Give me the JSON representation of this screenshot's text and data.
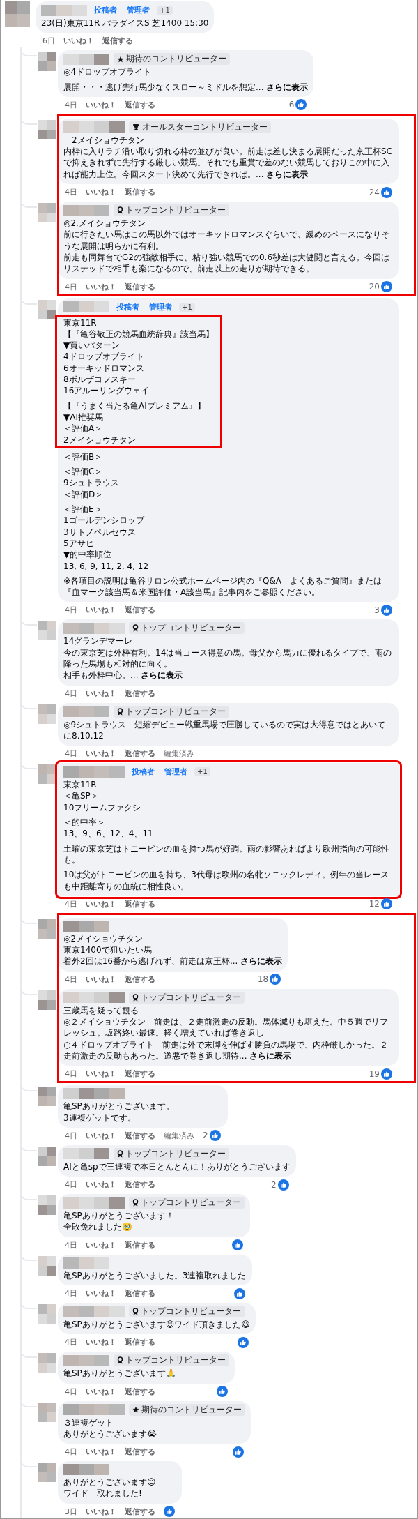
{
  "post": {
    "roles": [
      "投稿者",
      "管理者"
    ],
    "role_more": "+1",
    "paragraphs": [
      [
        "23(日)東京11R パラダイスS 芝1400 15:30"
      ]
    ],
    "date": "6日",
    "like": "いいね！",
    "reply": "返信する",
    "reaction": false
  },
  "replies": [
    {
      "kind": "comment",
      "badge": {
        "kind": "star",
        "label": "期待のコントリビューター"
      },
      "paragraphs": [
        [
          "◎4ドロップオブライト"
        ],
        [
          "展開・・・逃げ先行馬少なくスロー～ミドルを想定..."
        ]
      ],
      "see_more": "さらに表示",
      "date": "4日",
      "like": "いいね！",
      "reply": "返信する",
      "reaction": true,
      "reaction_count": "6"
    },
    {
      "kind": "highlight",
      "comments": [
        {
          "badge": {
            "kind": "trophy",
            "label": "オールスターコントリビューター"
          },
          "paragraphs": [
            [
              "　2メイショウチタン",
              "内枠に入りラチ沿い取り切れる枠の並びが良い。前走は差し決まる展開だった京王杯SCで抑えきれずに先行する厳しい競馬。それでも重賞で差のない競馬しておりこの中に入れば能力上位。今回スタート決めて先行できれば。..."
            ]
          ],
          "see_more": "さらに表示",
          "date": "4日",
          "like": "いいね！",
          "reply": "返信する",
          "reaction": true,
          "reaction_count": "24"
        },
        {
          "badge": {
            "kind": "medal",
            "label": "トップコントリビューター"
          },
          "paragraphs": [
            [
              "◎2.メイショウチタン",
              "前に行きたい馬はこの馬以外ではオーキッドロマンスぐらいで、緩めのペースになりそうな展開は明らかに有利。",
              "前走も同舞台でG2の強敵相手に、粘り強い競馬での0.6秒差は大健闘と言える。今回はリステッドで相手も楽になるので、前走以上の走りが期待できる。"
            ]
          ],
          "date": "4日",
          "like": "いいね！",
          "reply": "返信する",
          "reaction": true,
          "reaction_count": "20"
        }
      ]
    },
    {
      "kind": "comment",
      "roles": [
        "投稿者",
        "管理者"
      ],
      "role_more": "+1",
      "sections": [
        {
          "highlighted": true,
          "paragraphs": [
            [
              "東京11R",
              "【『亀谷敬正の競馬血統辞典』該当馬】",
              "▼買いパターン",
              "4ドロップオブライト",
              "6オーキッドロマンス",
              "8ボルザコフスキー",
              "16アルーリングウェイ"
            ],
            [
              "【『うまく当たる亀AIプレミアム』】",
              "▼AI推奨馬",
              "＜評価A＞",
              "2メイショウチタン"
            ]
          ]
        },
        {
          "highlighted": false,
          "paragraphs": [
            [
              "＜評価B＞"
            ],
            [
              "＜評価C＞",
              "9シュトラウス",
              "＜評価D＞"
            ],
            [
              "＜評価E＞",
              "1ゴールデンシロップ",
              "3サトノペルセウス",
              "5アサヒ",
              "▼的中率順位",
              "13, 6, 9, 11, 2, 4, 12"
            ],
            [
              "※各項目の説明は亀谷サロン公式ホームページ内の『Q&A　よくあるご質問』または『血マーク該当馬＆米国評価・A該当馬』記事内をご参照ください。"
            ]
          ]
        }
      ],
      "date": "4日",
      "like": "いいね！",
      "reply": "返信する",
      "reaction": true,
      "reaction_count": "3"
    },
    {
      "kind": "comment",
      "badge": {
        "kind": "medal",
        "label": "トップコントリビューター"
      },
      "paragraphs": [
        [
          "14グランデマーレ",
          "今の東京芝は外枠有利。14は当コース得意の馬。母父から馬力に優れるタイプで、雨の降った馬場も相対的に向く。",
          "相手も外枠中心。..."
        ]
      ],
      "see_more": "さらに表示",
      "date": "4日",
      "like": "いいね！",
      "reply": "返信する",
      "reaction": false
    },
    {
      "kind": "comment",
      "badge": {
        "kind": "medal",
        "label": "トップコントリビューター"
      },
      "paragraphs": [
        [
          "◎9シュトラウス　短縮デビュー戦重馬場で圧勝しているので実は大得意ではとあいてに8.10.12"
        ]
      ],
      "date": "4日",
      "like": "いいね！",
      "reply": "返信する",
      "edited": "編集済み",
      "reaction": false
    },
    {
      "kind": "comment",
      "highlighted": true,
      "roles": [
        "投稿者",
        "管理者"
      ],
      "role_more": "+1",
      "paragraphs": [
        [
          "東京11R",
          "＜亀SP＞",
          "10フリームファクシ"
        ],
        [
          "＜的中率＞",
          "13、9、6、12、4、11"
        ],
        [
          "土曜の東京芝はトニービンの血を持つ馬が好調。雨の影響あればより欧州指向の可能性も。"
        ],
        [
          "10は父がトニービンの血を持ち、3代母は欧州の名牝ソニックレディ。例年の当レースも中距離寄りの血統に相性良い。"
        ]
      ],
      "date": "4日",
      "like": "いいね！",
      "reply": "返信する",
      "reaction": true,
      "reaction_count": "12"
    },
    {
      "kind": "highlight",
      "comments": [
        {
          "paragraphs": [
            [
              "◎2メイショウチタン",
              "東京1400で狙いたい馬",
              "着外2回は16番から逃げれず、前走は京王杯..."
            ]
          ],
          "see_more": "さらに表示",
          "date": "4日",
          "like": "いいね！",
          "reply": "返信する",
          "reaction": true,
          "reaction_count": "18"
        },
        {
          "badge": {
            "kind": "medal",
            "label": "トップコントリビューター"
          },
          "paragraphs": [
            [
              "三歳馬を疑って観る",
              "◎２メイショウチタン　前走は、２走前激走の反動。馬体減りも堪えた。中５週でリフレッシュ。坂路終い最速。軽く増えていれば巻き返し",
              "○４ドロップオブライト　前走は外で末脚を伸ばす勝負の馬場で、内枠厳しかった。２走前激走の反動もあった。道悪で巻き返し期待..."
            ]
          ],
          "see_more": "さらに表示",
          "date": "4日",
          "like": "いいね！",
          "reply": "返信する",
          "reaction": true,
          "reaction_count": "19"
        }
      ]
    },
    {
      "kind": "comment",
      "paragraphs": [
        [
          "亀SPありがとうございます。",
          "3連複ゲットです。"
        ]
      ],
      "date": "4日",
      "like": "いいね！",
      "reply": "返信する",
      "edited": "編集済み",
      "reaction": true,
      "reaction_count": "2"
    },
    {
      "kind": "comment",
      "badge": {
        "kind": "medal",
        "label": "トップコントリビューター"
      },
      "paragraphs": [
        [
          "AIと亀spで三連複で本日とんとんに！ありがとうございます"
        ]
      ],
      "date": "4日",
      "like": "いいね！",
      "reply": "返信する",
      "reaction": true,
      "reaction_count": "2"
    },
    {
      "kind": "comment",
      "badge": {
        "kind": "medal",
        "label": "トップコントリビューター"
      },
      "paragraphs": [
        [
          "亀SPありがとうございます！",
          "全敗免れました🥹"
        ]
      ],
      "date": "4日",
      "like": "いいね！",
      "reply": "返信する",
      "reaction": true
    },
    {
      "kind": "comment",
      "paragraphs": [
        [
          "亀SPありがとうございました。3連複取れました"
        ]
      ],
      "date": "4日",
      "like": "いいね！",
      "reply": "返信する",
      "reaction": true
    },
    {
      "kind": "comment",
      "badge": {
        "kind": "medal",
        "label": "トップコントリビューター"
      },
      "paragraphs": [
        [
          "亀SPありがとうございます😊ワイド頂きました😋"
        ]
      ],
      "date": "4日",
      "like": "いいね！",
      "reply": "返信する",
      "reaction": true
    },
    {
      "kind": "comment",
      "badge": {
        "kind": "medal",
        "label": "トップコントリビューター"
      },
      "paragraphs": [
        [
          "亀SPありがとうございます🙏"
        ]
      ],
      "date": "4日",
      "like": "いいね！",
      "reply": "返信する",
      "reaction": true
    },
    {
      "kind": "comment",
      "badge": {
        "kind": "star",
        "label": "期待のコントリビューター"
      },
      "paragraphs": [
        [
          "３連複ゲット",
          "ありがとうございます😭"
        ]
      ],
      "date": "4日",
      "like": "いいね！",
      "reply": "返信する",
      "reaction": true
    },
    {
      "kind": "comment",
      "paragraphs": [
        [
          "ありがとうございます😊",
          "ワイド　取れました!"
        ]
      ],
      "date": "3日",
      "like": "いいね！",
      "reply": "返信する",
      "reaction": true
    }
  ]
}
